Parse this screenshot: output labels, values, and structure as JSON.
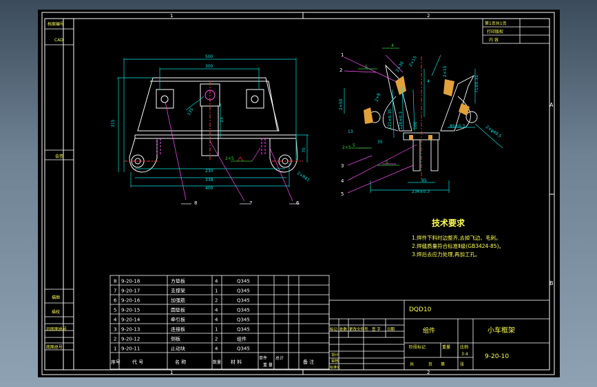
{
  "colors": {
    "viewport_bg": "#000000",
    "frame": "#ffffff",
    "part_line": "#ffffff",
    "dimension": "#00e5e5",
    "hatch": "#e2a13a",
    "annotation_green": "#33dd33",
    "leader": "#ff55ff",
    "red": "#ff3333",
    "text_yellow": "#ffff44"
  },
  "zone_labels": {
    "top_1": "1",
    "top_2": "2",
    "bottom_1": "1",
    "bottom_2": "2",
    "side_a": "A",
    "side_b": "B"
  },
  "left_strip": {
    "doc_no": "档案编号",
    "cad": "CAD",
    "sign": "会签",
    "draw": "描图",
    "trace": "描校",
    "old_doc": "旧底图总号",
    "base_doc": "底图总号"
  },
  "top_right_box": {
    "r1": "第1页共1页",
    "r2": "打印版权",
    "r3": "内 容"
  },
  "front_view": {
    "dim_top_outer": "500",
    "dim_top_inner": "300",
    "dim_height": "315",
    "dim_slot": "23",
    "dim_135": "135",
    "dim_bottom_inner": "230",
    "dim_bottom_mid": "338",
    "dim_bottom_outer": "400",
    "dim_70": "70",
    "dim_r": "2×R41",
    "weld_1": "2×5",
    "callout_8": "8",
    "callout_7": "7",
    "callout_6": "6"
  },
  "side_view": {
    "c1": "1",
    "c2": "2",
    "c3": "3",
    "c4": "4",
    "c5": "5",
    "w1": "4",
    "w2": "5",
    "w3": "5",
    "w4": "2×5",
    "w5": "5",
    "d13": "13",
    "d35": "35",
    "d50": "2×50",
    "d95": "95",
    "d85": "85±0.3",
    "d71": "71±0.35",
    "d236": "236±0.3",
    "d2x8": "2×8",
    "d2x30": "2×30",
    "d2x15": "2×15",
    "d121": "121±0.35",
    "d120": "120±0.3",
    "d100": "100",
    "d4p": "4",
    "d1p1": "2×15",
    "dphi": "2×φ49.5"
  },
  "tech": {
    "title": "技术要求",
    "l1": "1.焊件下料时边整齐,去掉飞边、毛刺。",
    "l2": "2.焊缝质量符合标准Ⅱ级(GB3424-85)。",
    "l3": "3.焊后去应力处理,再加工孔。"
  },
  "bom": {
    "rows": [
      {
        "no": "8",
        "code": "9-20-18",
        "name": "方垫板",
        "qty": "4",
        "mat": "Q345"
      },
      {
        "no": "7",
        "code": "9-20-17",
        "name": "支撑架",
        "qty": "1",
        "mat": "Q345"
      },
      {
        "no": "6",
        "code": "9-20-16",
        "name": "加强筋",
        "qty": "2",
        "mat": "Q345"
      },
      {
        "no": "5",
        "code": "9-20-15",
        "name": "圆垫板",
        "qty": "4",
        "mat": "Q345"
      },
      {
        "no": "4",
        "code": "9-20-14",
        "name": "牵引板",
        "qty": "4",
        "mat": "Q345"
      },
      {
        "no": "3",
        "code": "9-20-13",
        "name": "连接板",
        "qty": "1",
        "mat": "Q345"
      },
      {
        "no": "2",
        "code": "9-20-12",
        "name": "侧板",
        "qty": "2",
        "mat": "组件"
      },
      {
        "no": "1",
        "code": "9-20-11",
        "name": "止动块",
        "qty": "4",
        "mat": "Q345"
      }
    ],
    "header": {
      "no": "序号",
      "code": "代 号",
      "name": "名 称",
      "qty": "数量",
      "mat": "材 料",
      "unit": "单件",
      "total": "总计",
      "weight": "重 量",
      "remark": "备 注"
    }
  },
  "title_block": {
    "project": "DQD10",
    "category": "组件",
    "drawing_name": "小车框架",
    "drawing_no": "9-20-10",
    "mark": "标记",
    "count": "处数",
    "change_doc": "更改文件号",
    "sign": "签 字",
    "date": "日期",
    "stage": "阶段标记",
    "weight": "重量",
    "scale": "比例",
    "scale_value": "3:4",
    "design": "设计",
    "check": "审核",
    "total_pages": "共",
    "page": "页",
    "page_of": "第",
    "sheet": "张",
    "stage2": "标准化"
  }
}
